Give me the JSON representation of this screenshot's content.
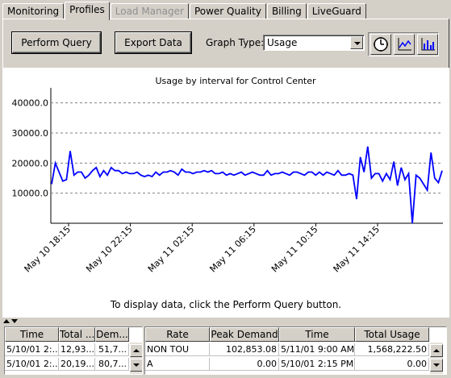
{
  "tabs": [
    {
      "label": "Monitoring",
      "state": "normal"
    },
    {
      "label": "Profiles",
      "state": "active"
    },
    {
      "label": "Load Manager",
      "state": "disabled"
    },
    {
      "label": "Power Quality",
      "state": "normal"
    },
    {
      "label": "Billing",
      "state": "normal"
    },
    {
      "label": "LiveGuard",
      "state": "normal"
    }
  ],
  "toolbar": {
    "perform_query_label": "Perform Query",
    "export_data_label": "Export Data",
    "graph_type_label": "Graph Type:",
    "graph_type_value": "Usage",
    "icons": [
      "clock-icon",
      "line-chart-icon",
      "bar-chart-icon"
    ]
  },
  "chart_data": {
    "type": "line",
    "title": "Usage by interval for Control Center",
    "ylim": [
      0,
      45000
    ],
    "y_ticks": [
      "10000.0",
      "20000.0",
      "30000.0",
      "40000.0"
    ],
    "x_ticks": [
      "May 10 18:15",
      "May 10 22:15",
      "May 11 02:15",
      "May 11 06:15",
      "May 11 10:15",
      "May 11 14:15"
    ],
    "grid": true,
    "color": "#0000ff",
    "series": [
      {
        "values": [
          13000,
          20000,
          17000,
          14000,
          14500,
          24000,
          16000,
          17000,
          17000,
          15000,
          16000,
          17500,
          18500,
          15500,
          17500,
          16000,
          18500,
          17500,
          17500,
          16500,
          17000,
          16500,
          16500,
          17000,
          16000,
          15500,
          16000,
          15500,
          17000,
          16000,
          17000,
          17000,
          17500,
          17000,
          16000,
          18000,
          17000,
          17000,
          16500,
          17000,
          17000,
          17500,
          17000,
          17500,
          16500,
          16500,
          17000,
          16000,
          16500,
          16000,
          16500,
          17000,
          16000,
          16500,
          17000,
          16500,
          16000,
          16000,
          17500,
          16000,
          16500,
          16500,
          17000,
          16500,
          16000,
          17000,
          17000,
          16500,
          16000,
          17000,
          17000,
          16000,
          17000,
          16000,
          17000,
          16500,
          16000,
          17500,
          16000,
          16000,
          16500,
          16000,
          8000,
          22000,
          17000,
          25500,
          15000,
          16500,
          16500,
          14000,
          16500,
          14500,
          20500,
          12500,
          18500,
          14500,
          16500,
          0,
          16000,
          15000,
          13000,
          11000,
          23500,
          15000,
          13500,
          17500
        ]
      }
    ]
  },
  "hint": "To display data, click the Perform Query button.",
  "left_table": {
    "headers": [
      "Time",
      "Total ...",
      "Dem..."
    ],
    "rows": [
      [
        "5/10/01 2:...",
        "12,93...",
        "51,7..."
      ],
      [
        "5/10/01 2:...",
        "20,19...",
        "80,7..."
      ]
    ]
  },
  "right_table": {
    "headers": [
      "Rate",
      "Peak Demand",
      "Time",
      "Total Usage"
    ],
    "rows": [
      [
        "NON TOU",
        "102,853.08",
        "5/11/01 9:00 AM",
        "1,568,222.50"
      ],
      [
        "A",
        "0.00",
        "5/10/01 2:15 PM",
        "0.00"
      ]
    ]
  }
}
